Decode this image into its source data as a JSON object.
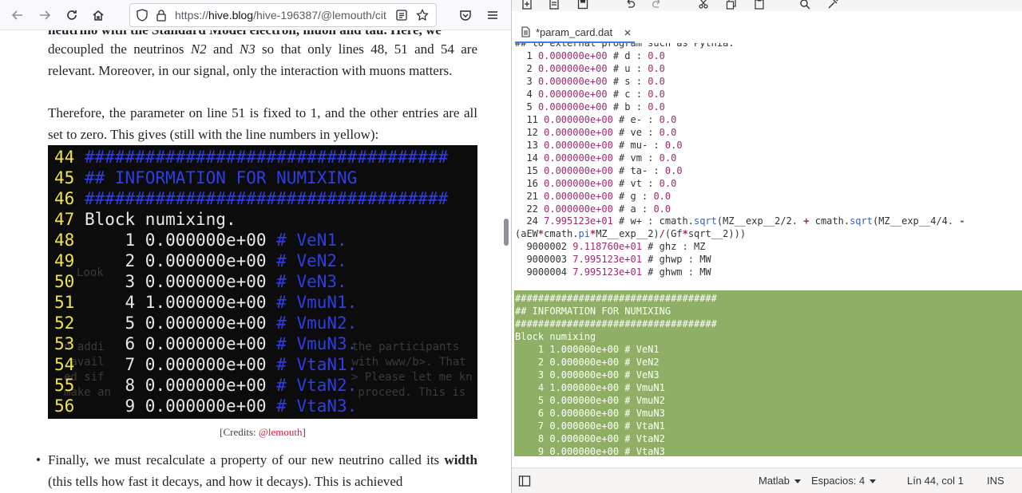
{
  "browser": {
    "url_scheme": "https://",
    "url_host": "hive.blog",
    "url_path": "/hive-196387/@lemouth/cit",
    "article": {
      "para_top": "neutrino with the Standard Model electron, muon and tau. Here, we",
      "para_decouple_a": "decoupled the neutrinos ",
      "para_decouple_n2": "N2",
      "para_decouple_b": " and ",
      "para_decouple_n3": "N3",
      "para_decouple_c": " so that only lines 48, 51 and 54 are relevant. Moreover, in our signal, only the interaction with muons matters.",
      "para_therefore": "Therefore, the parameter on line 51 is fixed to 1, and the other entries are all set to zero. This gives (still with the line numbers in yellow):",
      "code_lines": [
        {
          "num": "44",
          "text": " ####################################",
          "kind": "hash"
        },
        {
          "num": "45",
          "text": " ## INFORMATION FOR NUMIXING",
          "kind": "hash"
        },
        {
          "num": "46",
          "text": " ####################################",
          "kind": "hash"
        },
        {
          "num": "47",
          "text": " Block numixing.",
          "kind": "body"
        },
        {
          "num": "48",
          "text": "     1 0.000000e+00 ",
          "comment": "# VeN1.",
          "kind": "entry"
        },
        {
          "num": "49",
          "text": "     2 0.000000e+00 ",
          "comment": "# VeN2.",
          "kind": "entry"
        },
        {
          "num": "50",
          "text": "     3 0.000000e+00 ",
          "comment": "# VeN3.",
          "kind": "entry"
        },
        {
          "num": "51",
          "text": "     4 1.000000e+00 ",
          "comment": "# VmuN1.",
          "kind": "entry"
        },
        {
          "num": "52",
          "text": "     5 0.000000e+00 ",
          "comment": "# VmuN2.",
          "kind": "entry"
        },
        {
          "num": "53",
          "text": "     6 0.000000e+00 ",
          "comment": "# VmuN3.",
          "kind": "entry"
        },
        {
          "num": "54",
          "text": "     7 0.000000e+00 ",
          "comment": "# VtaN1.",
          "kind": "entry"
        },
        {
          "num": "55",
          "text": "     8 0.000000e+00 ",
          "comment": "# VtaN2.",
          "kind": "entry"
        },
        {
          "num": "56",
          "text": "     9 0.000000e+00 ",
          "comment": "# VtaN3.",
          "kind": "entry"
        }
      ],
      "ghost_1": "Look",
      "ghost_2": "n addi",
      "ghost_3": " the participants",
      "ghost_4": " avail",
      "ghost_5": " with www/b>. That",
      "ghost_6": "ed sif",
      "ghost_7": "> Please let me kn",
      "ghost_8": "make an",
      "ghost_9": " proceed. This is",
      "credits_prefix": "[Credits: ",
      "credits_link": "@lemouth",
      "credits_suffix": "]",
      "bullet_a": "Finally, we must recalculate a property of our new neutrino called its ",
      "bullet_bold": "width",
      "bullet_b": " (this tells how fast it decays, and how it decays). This is achieved"
    }
  },
  "editor": {
    "tab_label": "*param_card.dat",
    "top_partial": "## to external program such as Pythia.",
    "lines": [
      {
        "n": "  1",
        "val": " 0.000000e+00",
        "name": "d",
        "rhs": "0.0"
      },
      {
        "n": "  2",
        "val": " 0.000000e+00",
        "name": "u",
        "rhs": "0.0"
      },
      {
        "n": "  3",
        "val": " 0.000000e+00",
        "name": "s",
        "rhs": "0.0"
      },
      {
        "n": "  4",
        "val": " 0.000000e+00",
        "name": "c",
        "rhs": "0.0"
      },
      {
        "n": "  5",
        "val": " 0.000000e+00",
        "name": "b",
        "rhs": "0.0"
      },
      {
        "n": "  11",
        "val": " 0.000000e+00",
        "name": "e-",
        "rhs": "0.0"
      },
      {
        "n": "  12",
        "val": " 0.000000e+00",
        "name": "ve",
        "rhs": "0.0"
      },
      {
        "n": "  13",
        "val": " 0.000000e+00",
        "name": "mu-",
        "rhs": "0.0"
      },
      {
        "n": "  14",
        "val": " 0.000000e+00",
        "name": "vm",
        "rhs": "0.0"
      },
      {
        "n": "  15",
        "val": " 0.000000e+00",
        "name": "ta-",
        "rhs": "0.0"
      },
      {
        "n": "  16",
        "val": " 0.000000e+00",
        "name": "vt",
        "rhs": "0.0"
      },
      {
        "n": "  21",
        "val": " 0.000000e+00",
        "name": "g",
        "rhs": "0.0"
      },
      {
        "n": "  22",
        "val": " 0.000000e+00",
        "name": "a",
        "rhs": "0.0"
      }
    ],
    "wplus_line_a": "  24 ",
    "wplus_val": "7.995123e+01",
    "wplus_line_b": " # w+ : ",
    "wplus_expr_1": "cmath.",
    "wplus_fn": "sqrt",
    "wplus_expr_2": "(MZ__exp__2/2. ",
    "wplus_plus": "+",
    "wplus_expr_3": " cmath.",
    "wplus_fn2": "sqrt",
    "wplus_expr_4": "(MZ__exp__4/4. ",
    "wplus_minus": "-",
    "wplus_cont_1": "(aEW",
    "wplus_star1": "*",
    "wplus_cont_2": "cmath.",
    "wplus_pi": "pi",
    "wplus_star2": "*",
    "wplus_cont_3": "MZ__exp__2)",
    "wplus_slash": "/",
    "wplus_cont_4": "(Gf",
    "wplus_star3": "*",
    "wplus_cont_5": "sqrt__2)))",
    "ghost_lines": [
      {
        "n": "  9000002 ",
        "val": "9.118760e+01",
        "rest": " # ghz : MZ"
      },
      {
        "n": "  9000003 ",
        "val": "7.995123e+01",
        "rest": " # ghwp : MW"
      },
      {
        "n": "  9000004 ",
        "val": "7.995123e+01",
        "rest": " # ghwm : MW"
      }
    ],
    "block": [
      "###################################",
      "## INFORMATION FOR NUMIXING",
      "###################################",
      "Block numixing",
      "    1 1.000000e+00 # VeN1",
      "    2 0.000000e+00 # VeN2",
      "    3 0.000000e+00 # VeN3",
      "    4 1.000000e+00 # VmuN1",
      "    5 0.000000e+00 # VmuN2",
      "    6 0.000000e+00 # VmuN3",
      "    7 0.000000e+00 # VtaN1",
      "    8 0.000000e+00 # VtaN2",
      "    9 0.000000e+00 # VtaN3"
    ],
    "status": {
      "language": "Matlab",
      "spaces": "Espacios: 4",
      "position": "Lín 44, col 1",
      "mode": "INS"
    }
  }
}
